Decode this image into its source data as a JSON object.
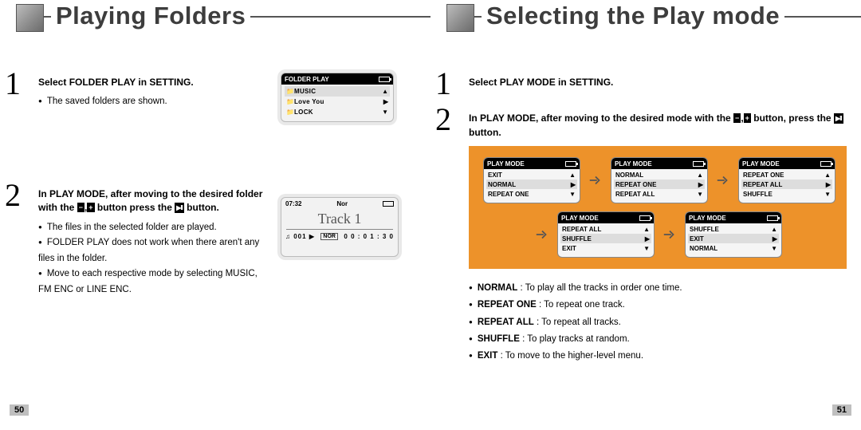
{
  "left": {
    "title": "Playing Folders",
    "step1_head": "Select FOLDER PLAY in SETTING.",
    "step1_b1": "The saved folders are shown.",
    "lcd1": {
      "header": "FOLDER PLAY",
      "row1": "MUSIC",
      "row2": "Love You",
      "row3": "LOCK"
    },
    "step2_head_a": "In PLAY MODE, after moving to the desired folder with the ",
    "step2_head_b": " button press the ",
    "step2_head_c": " button.",
    "step2_b1": "The files in the selected folder are played.",
    "step2_b2": "FOLDER PLAY does not work when there aren't any files in the folder.",
    "step2_b3": "Move to each respective mode by selecting MUSIC, FM ENC or LINE ENC.",
    "lcd2": {
      "time": "07:32",
      "nor": "Nor",
      "title": "Track 1",
      "track": "001",
      "elapsed": "0 0 : 0 1 : 3 0"
    },
    "pagenum": "50"
  },
  "right": {
    "title": "Selecting the Play mode",
    "step1_head": "Select PLAY MODE in SETTING.",
    "step2_head_a": "In PLAY MODE, after moving to the desired mode with the ",
    "step2_head_b": " button, press the ",
    "step2_head_c": "button.",
    "mini_header": "PLAY MODE",
    "modes": {
      "m1": [
        "EXIT",
        "NORMAL",
        "REPEAT ONE"
      ],
      "m2": [
        "NORMAL",
        "REPEAT ONE",
        "REPEAT ALL"
      ],
      "m3": [
        "REPEAT ONE",
        "REPEAT ALL",
        "SHUFFLE"
      ],
      "m4": [
        "REPEAT ALL",
        "SHUFFLE",
        "EXIT"
      ],
      "m5": [
        "SHUFFLE",
        "EXIT",
        "NORMAL"
      ]
    },
    "defs": {
      "d1_term": "NORMAL",
      "d1_txt": " : To play all the tracks in order one time.",
      "d2_term": "REPEAT ONE",
      "d2_txt": " : To repeat one track.",
      "d3_term": "REPEAT ALL",
      "d3_txt": " : To repeat all tracks.",
      "d4_term": "SHUFFLE",
      "d4_txt": " : To play tracks at random.",
      "d5_term": "EXIT",
      "d5_txt": " : To move to the higher-level menu."
    },
    "pagenum": "51"
  }
}
